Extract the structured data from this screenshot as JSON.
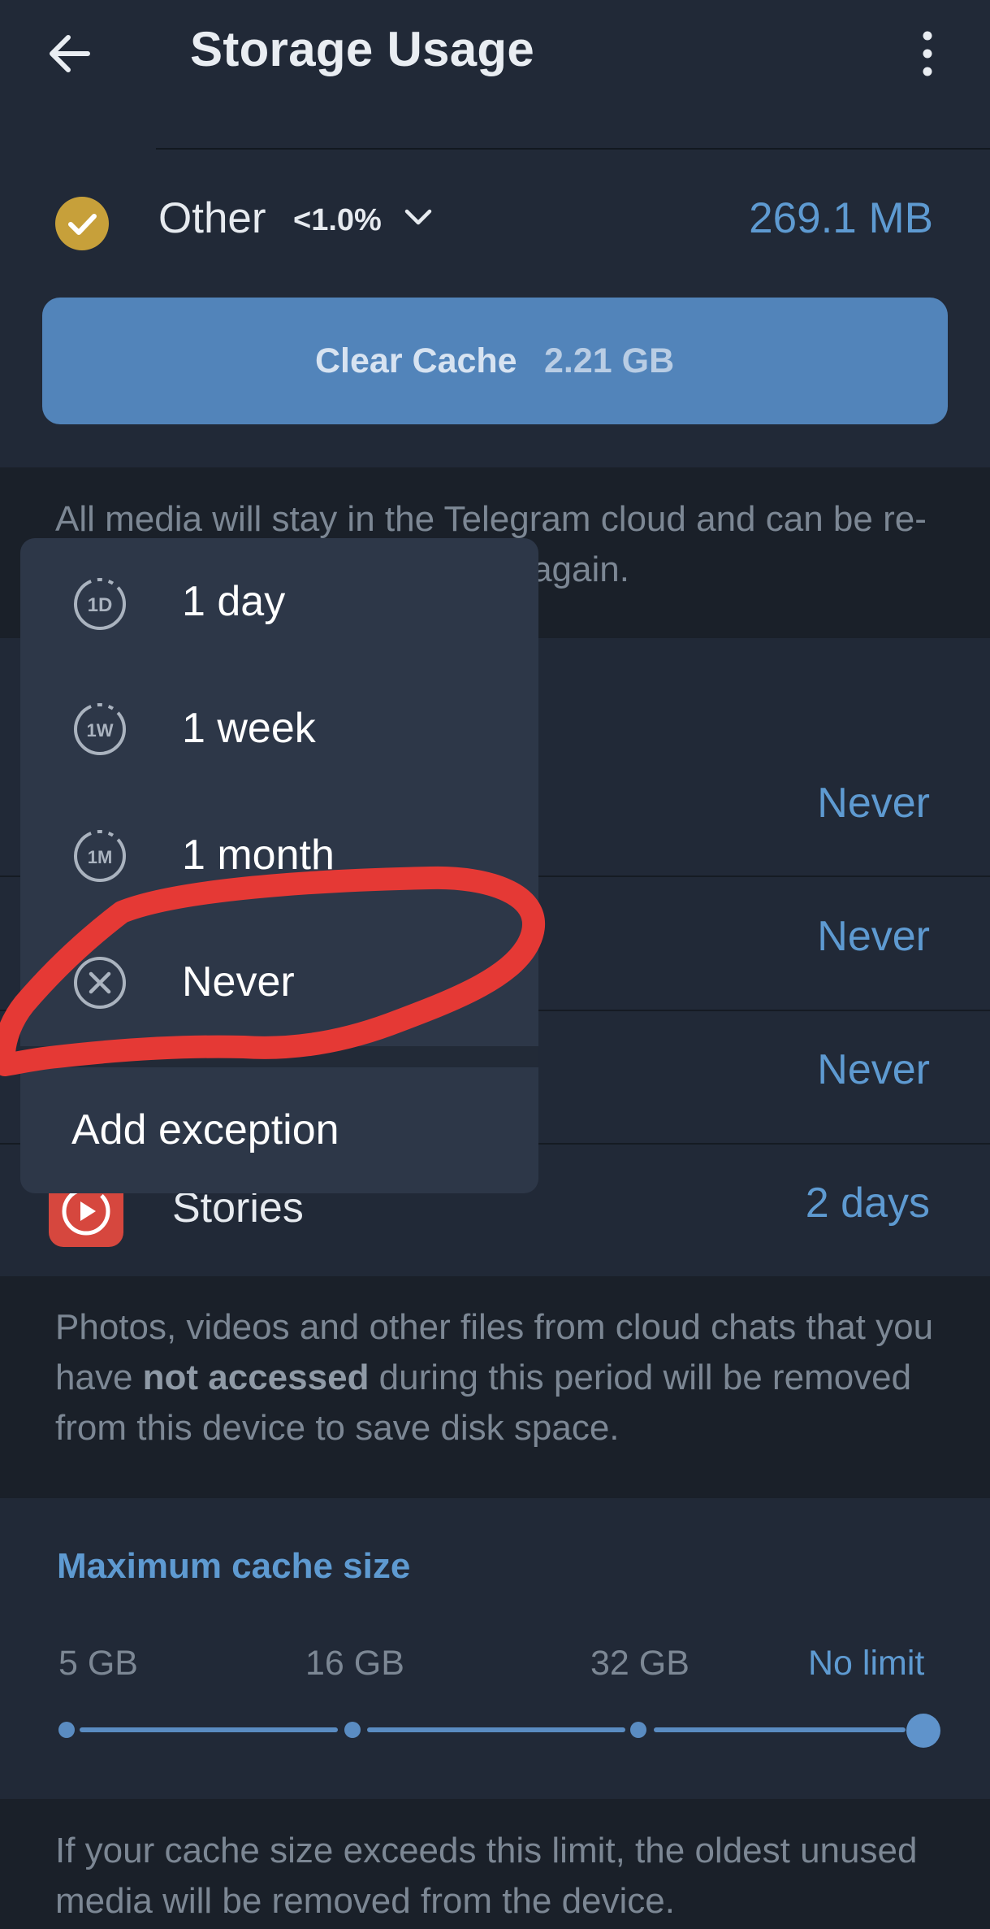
{
  "header": {
    "title": "Storage Usage",
    "back_icon": "arrow-left-icon",
    "menu_icon": "more-vertical-icon"
  },
  "storage": {
    "other_label": "Other",
    "other_percent": "<1.0%",
    "other_size": "269.1 MB",
    "clear_button_label": "Clear Cache",
    "clear_button_size": "2.21 GB"
  },
  "info_top": "All media will stay in the Telegram cloud and can be re-downloaded if you need them again.",
  "keep_media": {
    "rows": [
      {
        "value": "Never"
      },
      {
        "value": "Never"
      },
      {
        "value": "Never"
      },
      {
        "label": "Stories",
        "value": "2 days",
        "icon": "stories-icon"
      }
    ]
  },
  "info_middle": {
    "before": "Photos, videos and other files from cloud chats that you have ",
    "bold": "not accessed",
    "after": " during this period will be removed from this device to save disk space."
  },
  "max_cache": {
    "title": "Maximum cache size",
    "ticks": [
      "5 GB",
      "16 GB",
      "32 GB",
      "No limit"
    ],
    "selected": "No limit"
  },
  "info_bottom": "If your cache size exceeds this limit, the oldest unused media will be removed from the device.",
  "popup_menu": {
    "items": [
      {
        "label": "1 day",
        "icon": "1d-timer-icon",
        "badge": "1D"
      },
      {
        "label": "1 week",
        "icon": "1w-timer-icon",
        "badge": "1W"
      },
      {
        "label": "1 month",
        "icon": "1m-timer-icon",
        "badge": "1M"
      },
      {
        "label": "Never",
        "icon": "circle-x-icon"
      }
    ],
    "add_exception": "Add exception"
  },
  "colors": {
    "background": "#1a2029",
    "card": "#212937",
    "accent": "#5e9ad1",
    "button": "#5284ba",
    "popup": "#2d3748",
    "annotation": "#e53935"
  }
}
